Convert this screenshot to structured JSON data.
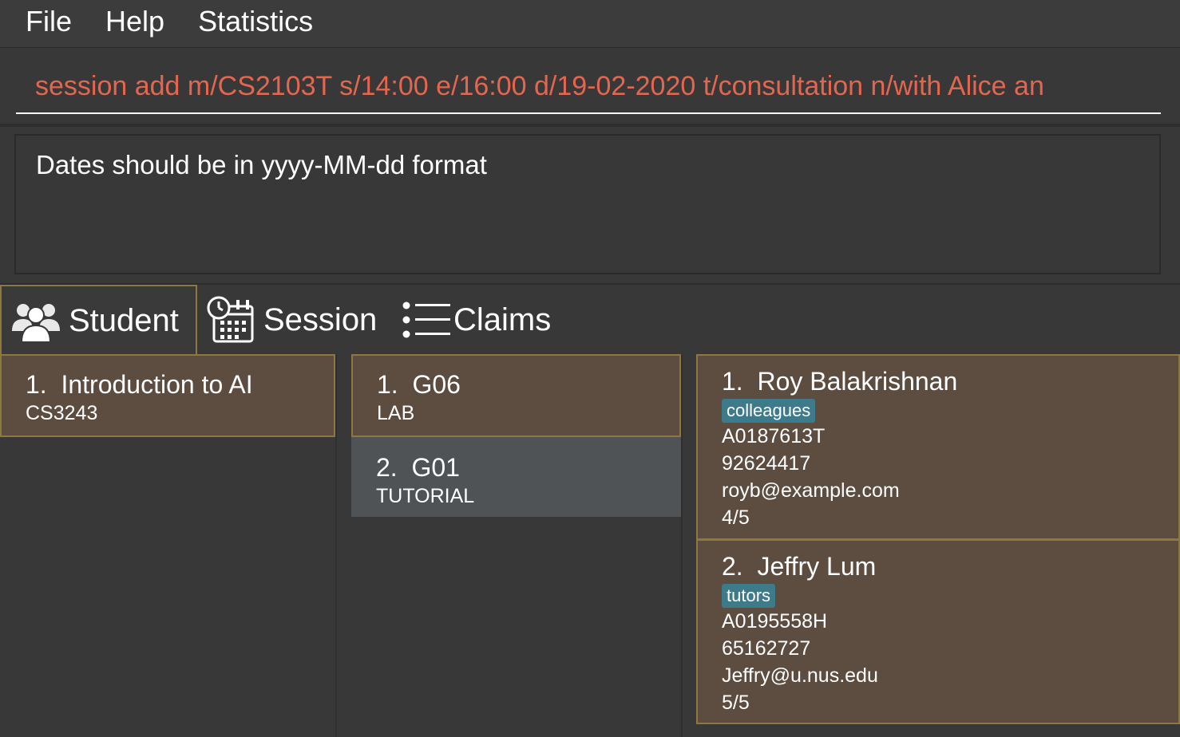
{
  "menu": {
    "items": [
      "File",
      "Help",
      "Statistics"
    ]
  },
  "command": {
    "value": "session add m/CS2103T s/14:00 e/16:00 d/19-02-2020 t/consultation n/with Alice an"
  },
  "result": {
    "message": "Dates should be in yyyy-MM-dd format"
  },
  "tabs": [
    {
      "label": "Student",
      "icon": "students-icon",
      "active": true
    },
    {
      "label": "Session",
      "icon": "calendar-clock-icon",
      "active": false
    },
    {
      "label": "Claims",
      "icon": "list-icon",
      "active": false
    }
  ],
  "modules": [
    {
      "index": "1.",
      "name": "Introduction to AI",
      "code": "CS3243"
    }
  ],
  "groups": [
    {
      "index": "1.",
      "name": "G06",
      "type": "LAB"
    },
    {
      "index": "2.",
      "name": "G01",
      "type": "TUTORIAL"
    }
  ],
  "students": [
    {
      "index": "1.",
      "name": "Roy Balakrishnan",
      "tag": "colleagues",
      "matric": "A0187613T",
      "phone": "92624417",
      "email": "royb@example.com",
      "rating": "4/5"
    },
    {
      "index": "2.",
      "name": "Jeffry Lum",
      "tag": "tutors",
      "matric": "A0195558H",
      "phone": "65162727",
      "email": "Jeffry@u.nus.edu",
      "rating": "5/5"
    }
  ],
  "colors": {
    "command_text": "#e5664f",
    "card_bg": "#5d4c40",
    "card_border": "#8e7840",
    "tag_bg": "#3d7a8a",
    "selected_bg": "#4f5356"
  }
}
